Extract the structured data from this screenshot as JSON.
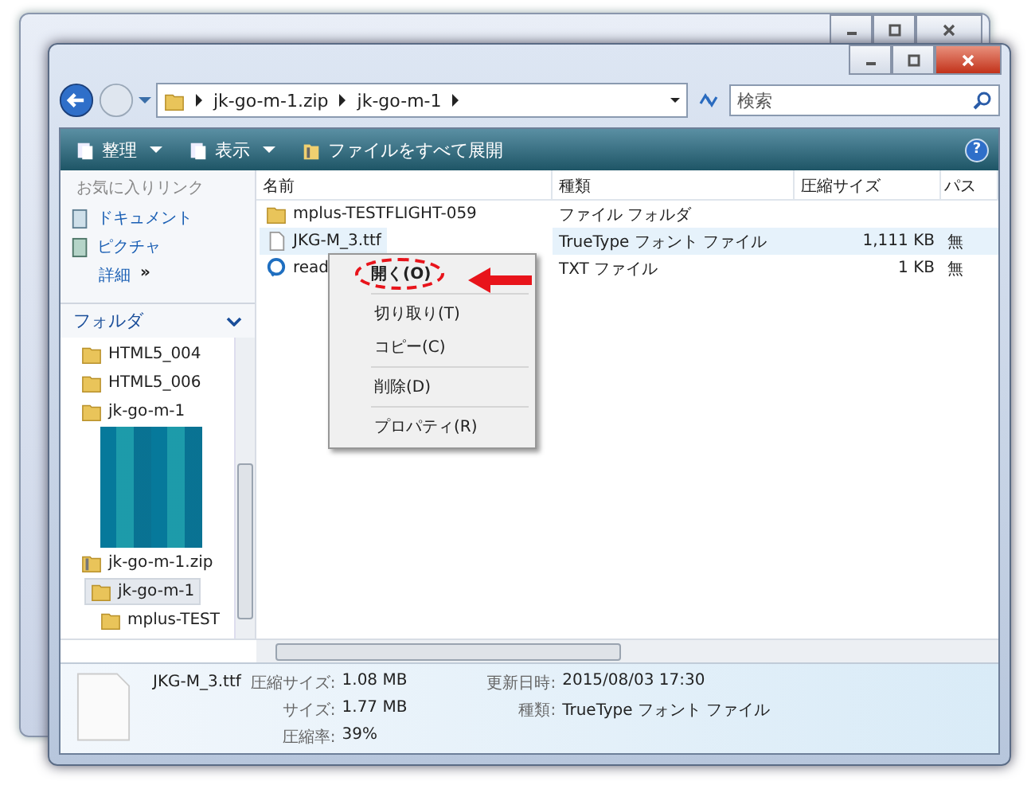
{
  "address": {
    "segments": [
      "jk-go-m-1.zip",
      "jk-go-m-1"
    ]
  },
  "search": {
    "placeholder": "検索"
  },
  "toolbar": [
    {
      "label": "整理",
      "kind": "menu"
    },
    {
      "label": "表示",
      "kind": "menu"
    },
    {
      "label": "ファイルをすべて展開",
      "kind": "action"
    }
  ],
  "help": {
    "label": "?"
  },
  "sidebar": {
    "favorites_title": "お気に入りリンク",
    "favorites": [
      {
        "label": "ドキュメント",
        "kind": "doc"
      },
      {
        "label": "ピクチャ",
        "kind": "pic"
      }
    ],
    "more": {
      "label": "詳細",
      "arrows": "»"
    },
    "folders_title": "フォルダ",
    "tree": [
      {
        "label": "HTML5_004",
        "selected": false
      },
      {
        "label": "HTML5_006",
        "selected": false
      },
      {
        "label": "jk-go-m-1",
        "selected": false
      },
      {
        "label": "jk-go-m-1.zip",
        "selected": false,
        "kind": "zip",
        "children": [
          {
            "label": "jk-go-m-1",
            "selected": true,
            "children": [
              {
                "label": "mplus-TEST",
                "selected": false
              }
            ]
          }
        ]
      }
    ]
  },
  "table": {
    "columns": [
      "名前",
      "種類",
      "圧縮サイズ",
      "パス"
    ],
    "rows": [
      {
        "kind": "folder",
        "name": "mplus-TESTFLIGHT-059",
        "type": "ファイル フォルダ",
        "size": "",
        "column_4": "",
        "selected": false
      },
      {
        "kind": "file",
        "name": "JKG-M_3.ttf",
        "type": "TrueType フォント ファイル",
        "size": "1,111 KB",
        "column_4": "無",
        "selected": true
      },
      {
        "kind": "text",
        "name": "read",
        "type": "TXT ファイル",
        "size": "1 KB",
        "column_4": "無",
        "selected": false
      }
    ]
  },
  "context_menu": {
    "groups": [
      [
        {
          "label": "開く(O)",
          "default": true,
          "highlighted": true
        }
      ],
      [
        {
          "label": "切り取り(T)",
          "default": false,
          "highlighted": false
        },
        {
          "label": "コピー(C)",
          "default": false,
          "highlighted": false
        }
      ],
      [
        {
          "label": "削除(D)",
          "default": false,
          "highlighted": false
        }
      ],
      [
        {
          "label": "プロパティ(R)",
          "default": false,
          "highlighted": false
        }
      ]
    ]
  },
  "details": {
    "name": "JKG-M_3.ttf",
    "left": [
      {
        "label": "圧縮サイズ:",
        "value": "1.08 MB"
      },
      {
        "label": "サイズ:",
        "value": "1.77 MB"
      },
      {
        "label": "圧縮率:",
        "value": "39%"
      }
    ],
    "right": [
      {
        "label": "更新日時:",
        "value": "2015/08/03 17:30"
      },
      {
        "label": "種類:",
        "value": "TrueType フォント ファイル"
      }
    ]
  }
}
